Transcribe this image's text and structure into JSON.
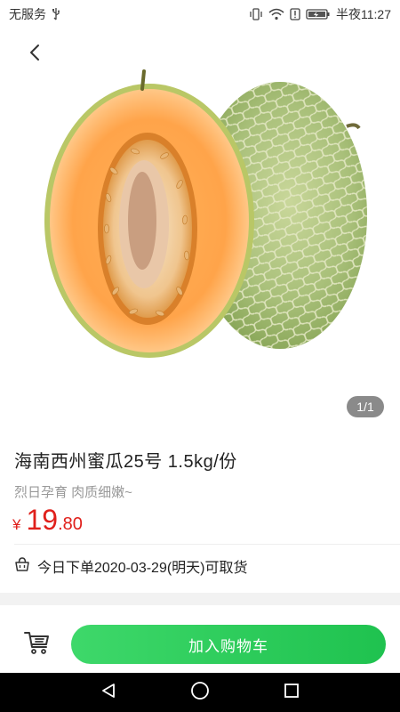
{
  "status_bar": {
    "carrier": "无服务",
    "time": "半夜11:27"
  },
  "product": {
    "image_counter": "1/1",
    "title": "海南西州蜜瓜25号 1.5kg/份",
    "subtitle": "烈日孕育 肉质细嫩~",
    "price_currency": "¥",
    "price_integer": "19",
    "price_decimal": ".80",
    "pickup_text": "今日下单2020-03-29(明天)可取货"
  },
  "actions": {
    "add_to_cart_label": "加入购物车"
  },
  "icons": {
    "usb": "usb-icon",
    "vibrate": "vibrate-icon",
    "wifi": "wifi-icon",
    "sim_alert": "sim-alert-icon",
    "battery": "battery-icon",
    "back": "chevron-left-icon",
    "basket": "basket-icon",
    "cart": "cart-icon",
    "nav_back": "nav-back-icon",
    "nav_home": "nav-home-icon",
    "nav_recent": "nav-recent-icon"
  },
  "colors": {
    "price": "#e0201b",
    "accent_green": "#2ecc5a",
    "nav_bar": "#000000"
  }
}
